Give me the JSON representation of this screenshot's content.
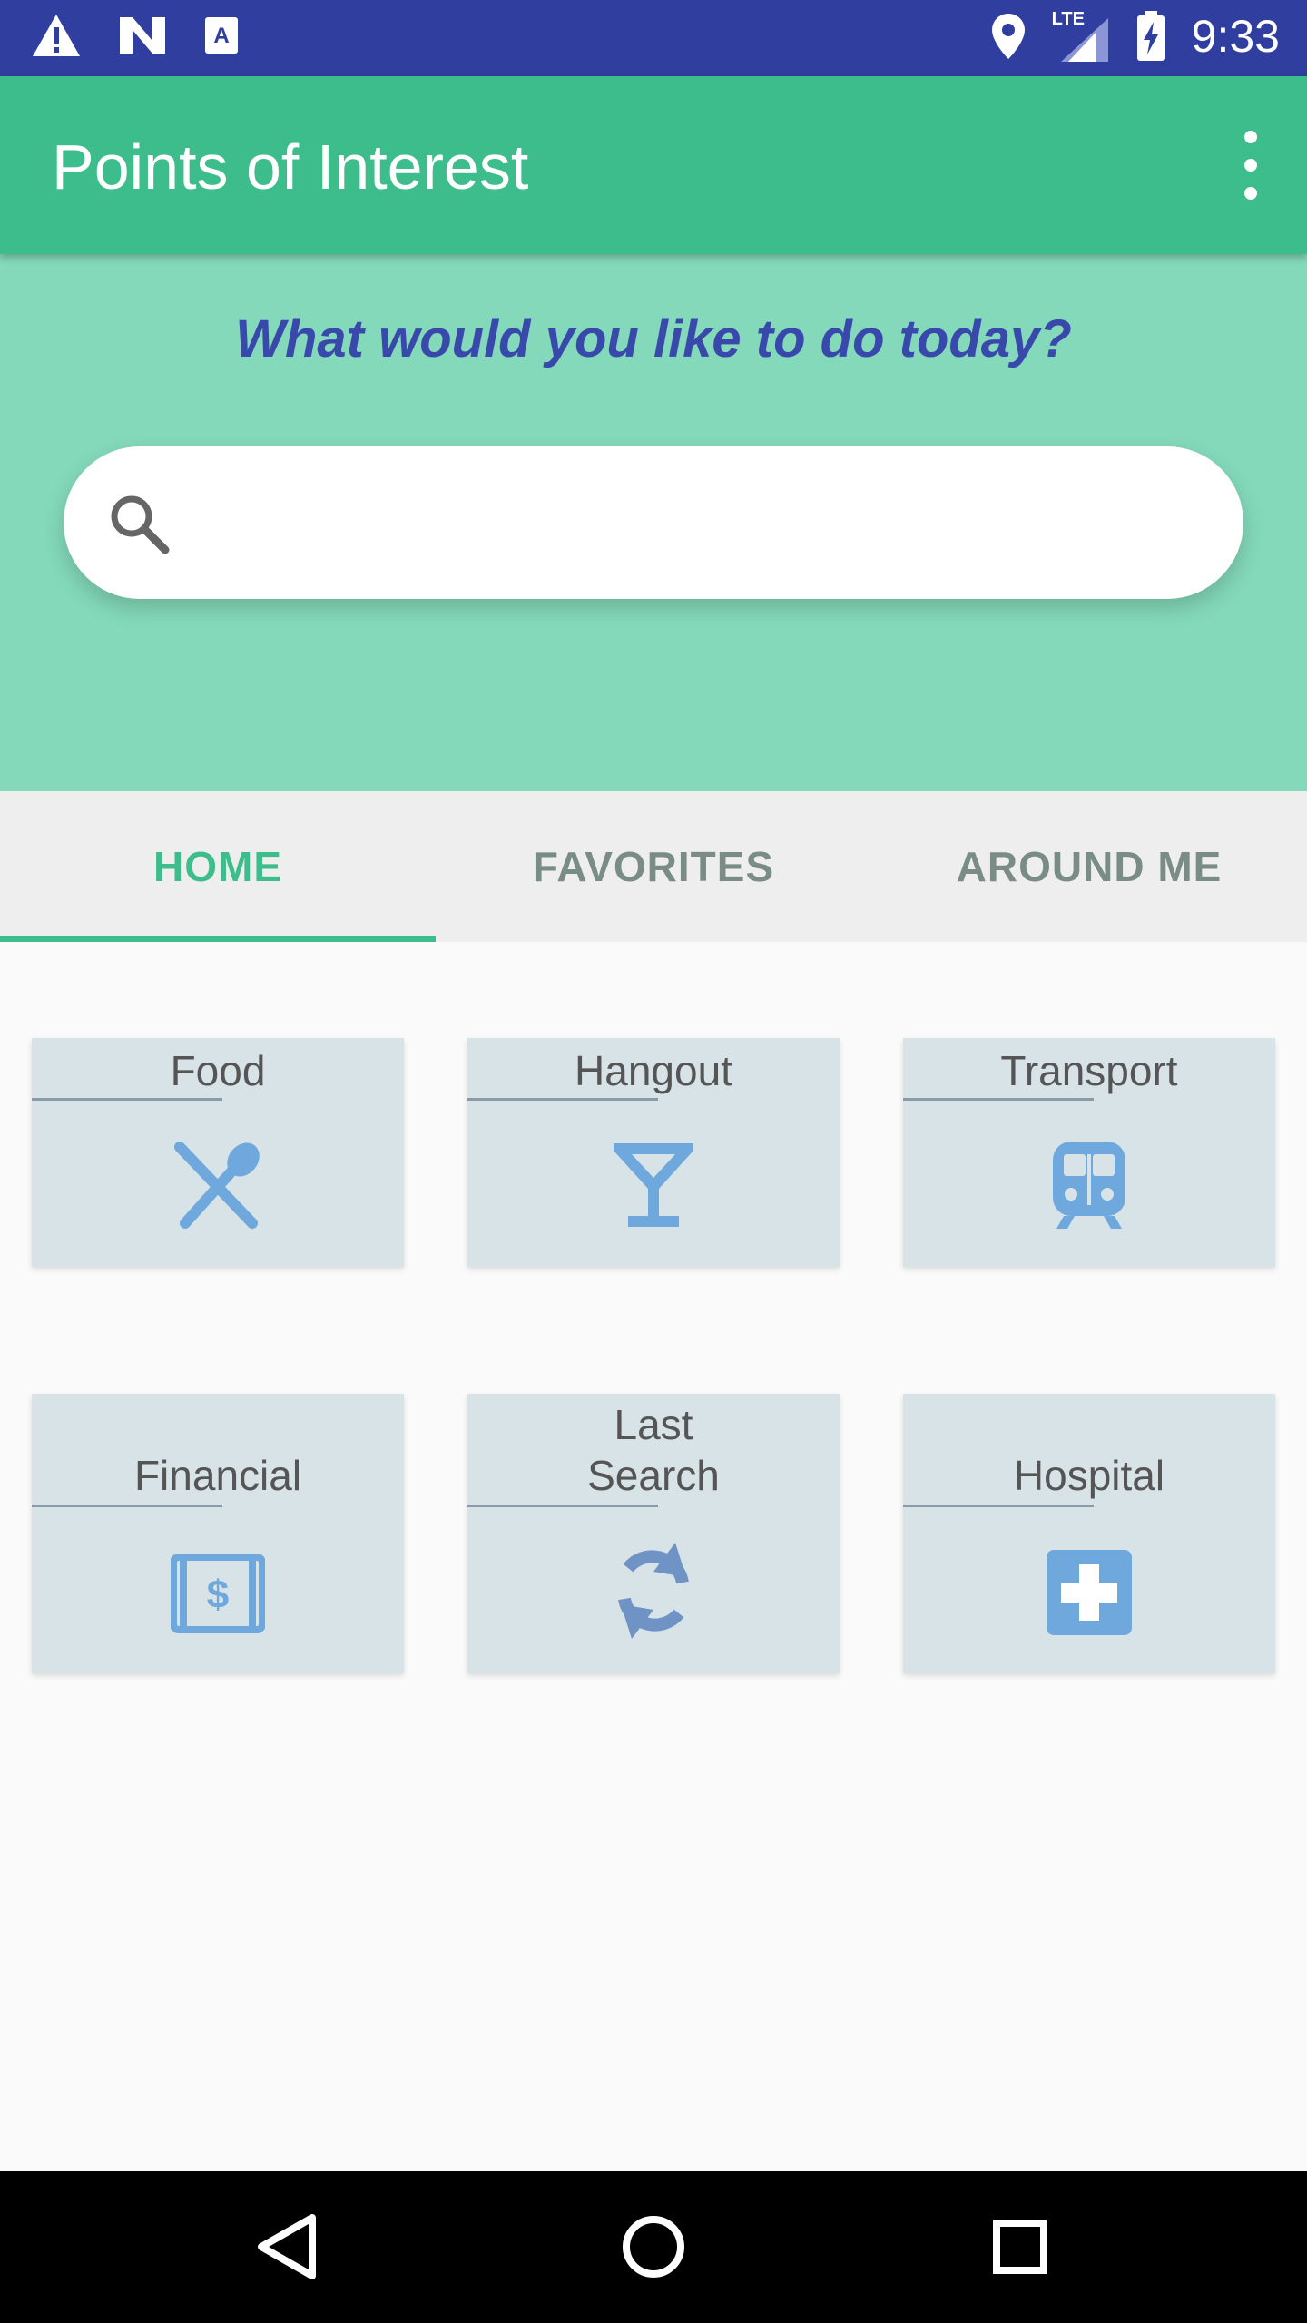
{
  "status_bar": {
    "time": "9:33",
    "network": "LTE",
    "icons": [
      "warning-icon",
      "n-icon",
      "a-icon",
      "location-icon",
      "signal-icon",
      "battery-charging-icon"
    ]
  },
  "app_bar": {
    "title": "Points of Interest",
    "menu_icon": "more-vert-icon"
  },
  "hero": {
    "question": "What would you like to do today?",
    "search": {
      "placeholder": "",
      "value": ""
    }
  },
  "tabs": [
    {
      "label": "HOME",
      "active": true
    },
    {
      "label": "FAVORITES",
      "active": false
    },
    {
      "label": "AROUND ME",
      "active": false
    }
  ],
  "categories": [
    {
      "label": "Food",
      "icon": "utensils-icon"
    },
    {
      "label": "Hangout",
      "icon": "cocktail-icon"
    },
    {
      "label": "Transport",
      "icon": "train-icon"
    },
    {
      "label": "Financial",
      "icon": "money-icon"
    },
    {
      "label": "Last\nSearch",
      "icon": "refresh-icon"
    },
    {
      "label": "Hospital",
      "icon": "hospital-icon"
    }
  ],
  "colors": {
    "status_bar": "#303f9f",
    "app_bar": "#3dbd8c",
    "hero": "#84d9bb",
    "question": "#3949ab",
    "tile": "#d8e3e8",
    "icon": "#6fa8dc",
    "tab_active": "#3dbd8c"
  },
  "nav_bar": {
    "icons": [
      "back-icon",
      "home-icon",
      "recents-icon"
    ]
  }
}
